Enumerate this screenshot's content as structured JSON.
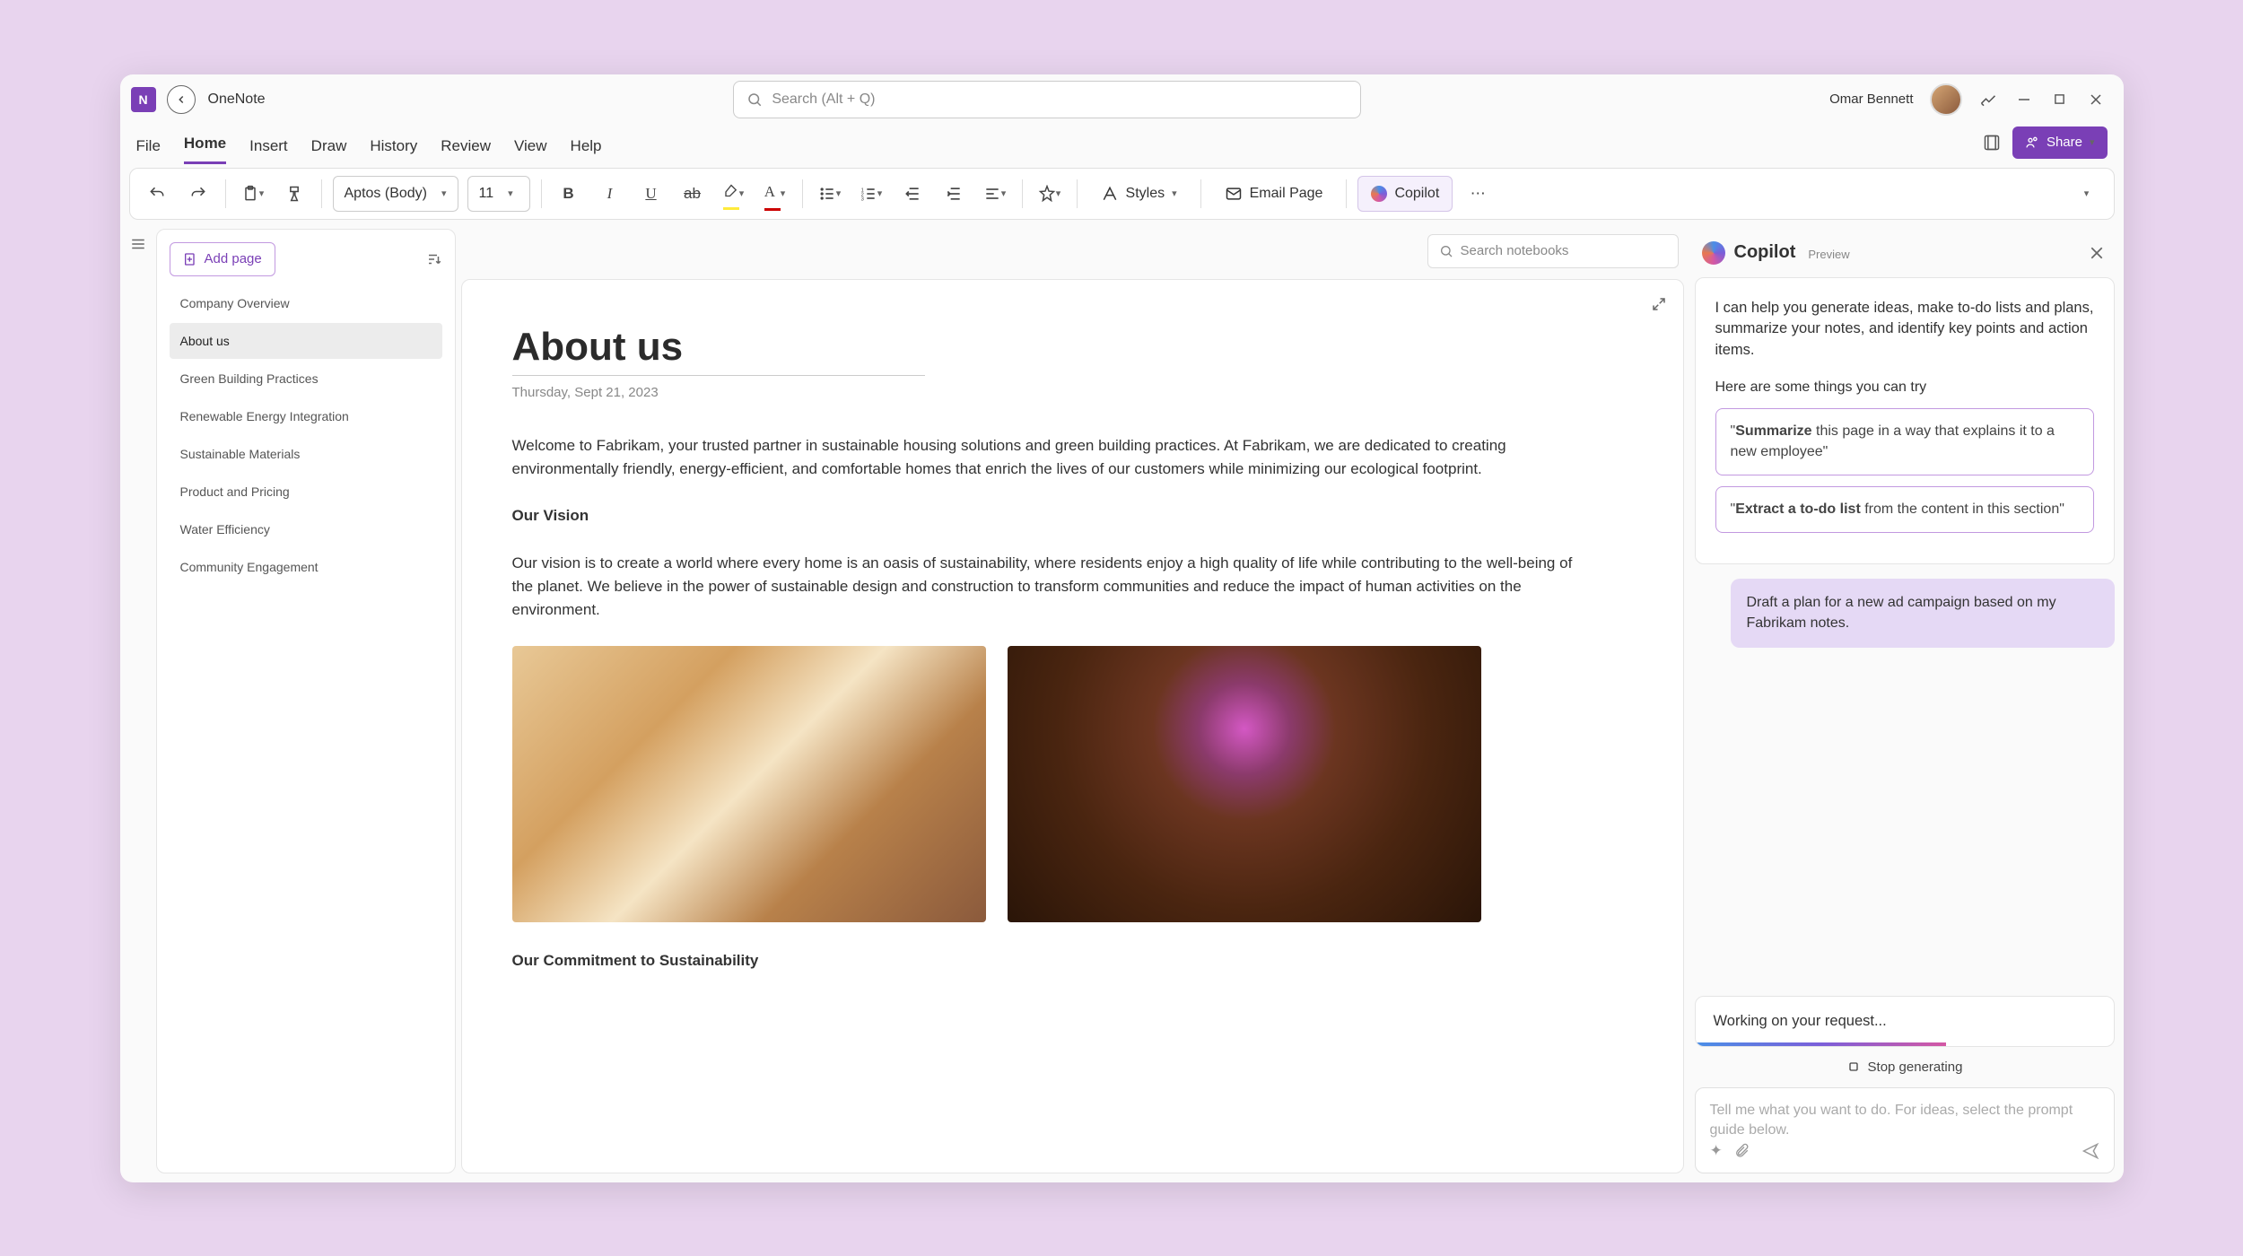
{
  "app": {
    "name": "OneNote"
  },
  "search": {
    "placeholder": "Search (Alt + Q)"
  },
  "user": {
    "name": "Omar Bennett"
  },
  "menu": {
    "items": [
      "File",
      "Home",
      "Insert",
      "Draw",
      "History",
      "Review",
      "View",
      "Help"
    ],
    "active": "Home",
    "share": "Share"
  },
  "ribbon": {
    "font": "Aptos (Body)",
    "size": "11",
    "styles": "Styles",
    "email": "Email Page",
    "copilot": "Copilot"
  },
  "search_notebooks": {
    "placeholder": "Search notebooks"
  },
  "page_list": {
    "add": "Add page",
    "items": [
      "Company Overview",
      "About us",
      "Green Building Practices",
      "Renewable Energy Integration",
      "Sustainable Materials",
      "Product and Pricing",
      "Water Efficiency",
      "Community Engagement"
    ],
    "active": "About us"
  },
  "note": {
    "title": "About us",
    "date": "Thursday, Sept 21, 2023",
    "intro": "Welcome to Fabrikam, your trusted partner in sustainable housing solutions and green building practices. At Fabrikam, we are dedicated to creating environmentally friendly, energy-efficient, and comfortable homes that enrich the lives of our customers while minimizing our ecological footprint.",
    "vision_head": "Our Vision",
    "vision": "Our vision is to create a world where every home is an oasis of sustainability, where residents enjoy a high quality of life while contributing to the well-being of the planet. We believe in the power of sustainable design and construction to transform communities and reduce the impact of human activities on the environment.",
    "commitment_head": "Our Commitment to Sustainability"
  },
  "copilot": {
    "title": "Copilot",
    "preview": "Preview",
    "intro": "I can help you generate ideas, make to-do lists and plans, summarize your notes, and identify key points and action items.",
    "subhead": "Here are some things you can try",
    "suggest1_bold": "Summarize",
    "suggest1_rest": " this page in a way that explains it to a new employee\"",
    "suggest2_bold": "Extract a to-do list",
    "suggest2_rest": " from the content in this section\"",
    "user_msg": "Draft a plan for a new ad campaign based on my Fabrikam notes.",
    "working": "Working on your request...",
    "stop": "Stop generating",
    "input_placeholder": "Tell me what you want to do. For ideas, select the prompt guide below."
  }
}
